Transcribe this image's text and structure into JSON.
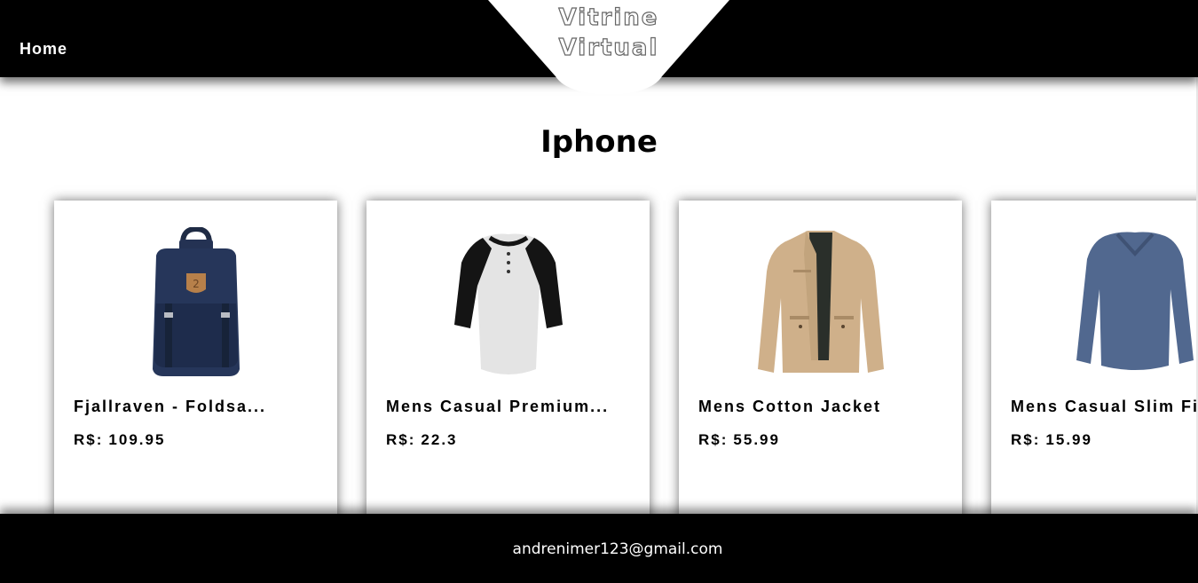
{
  "header": {
    "nav_home": "Home",
    "logo_line1": "Vitrine",
    "logo_line2": "Virtual"
  },
  "main": {
    "title": "Iphone",
    "products": [
      {
        "name": "Fjallraven - Foldsa...",
        "price_label": "R$:",
        "price": "109.95",
        "image_icon": "backpack-icon"
      },
      {
        "name": "Mens Casual Premium...",
        "price_label": "R$:",
        "price": "22.3",
        "image_icon": "raglan-tshirt-icon"
      },
      {
        "name": "Mens Cotton Jacket",
        "price_label": "R$:",
        "price": "55.99",
        "image_icon": "jacket-icon"
      },
      {
        "name": "Mens Casual Slim Fi",
        "price_label": "R$:",
        "price": "15.99",
        "image_icon": "long-sleeve-shirt-icon"
      }
    ]
  },
  "footer": {
    "email": "andrenimer123@gmail.com"
  },
  "colors": {
    "header_bg": "#000000",
    "footer_bg": "#000000",
    "page_bg": "#ffffff",
    "text": "#000000",
    "header_text": "#ffffff"
  }
}
